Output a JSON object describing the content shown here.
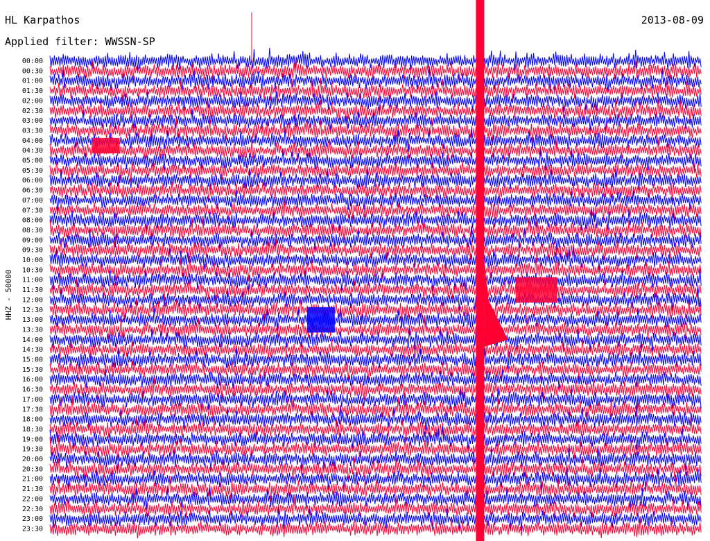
{
  "header": {
    "station": "HL Karpathos",
    "date": "2013-08-09",
    "filter": "Applied filter: WWSSN-SP"
  },
  "chart_data": {
    "type": "line",
    "title": "HL Karpathos",
    "subtitle": "Applied filter: WWSSN-SP",
    "date": "2013-08-09",
    "ylabel": "HHZ - 50000",
    "xlabel": "",
    "colors": [
      "#0000ff",
      "#ff0033"
    ],
    "row_labels": [
      "00:00",
      "00:30",
      "01:00",
      "01:30",
      "02:00",
      "02:30",
      "03:00",
      "03:30",
      "04:00",
      "04:30",
      "05:00",
      "05:30",
      "06:00",
      "06:30",
      "07:00",
      "07:30",
      "08:00",
      "08:30",
      "09:00",
      "09:30",
      "10:00",
      "10:30",
      "11:00",
      "11:30",
      "12:00",
      "12:30",
      "13:00",
      "13:30",
      "14:00",
      "14:30",
      "15:00",
      "15:30",
      "16:00",
      "16:30",
      "17:00",
      "17:30",
      "18:00",
      "18:30",
      "19:00",
      "19:30",
      "20:00",
      "20:30",
      "21:00",
      "21:30",
      "22:00",
      "22:30",
      "23:00",
      "23:30"
    ],
    "minutes_per_row": 30,
    "events": [
      {
        "row_start": 0,
        "row_end": 47,
        "minute": 19.8,
        "type": "large earthquake",
        "color": "#ff0033"
      },
      {
        "row_start": 25,
        "row_end": 27,
        "minute": 11.9,
        "type": "local event",
        "color": "#0000ff"
      },
      {
        "row_start": 8,
        "row_end": 9,
        "minute": 2.0,
        "type": "local event",
        "color": "#ff0033"
      },
      {
        "row_start": 22,
        "row_end": 24,
        "minute": 21.5,
        "type": "aftershock coda",
        "color": "#ff0033"
      }
    ]
  }
}
